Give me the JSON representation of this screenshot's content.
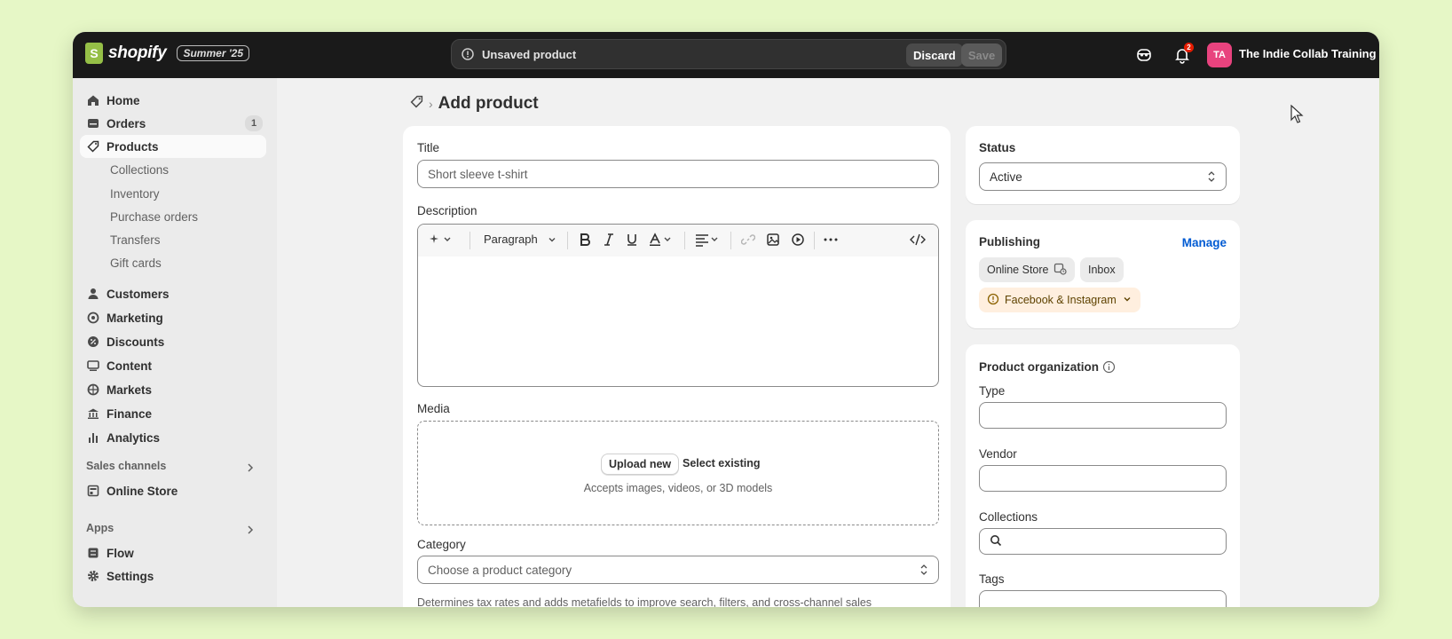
{
  "topbar": {
    "brand": "shopify",
    "logo_mark": "S",
    "edition": "Summer '25",
    "unsaved_label": "Unsaved product",
    "discard_label": "Discard",
    "save_label": "Save",
    "notification_count": "2",
    "avatar_initials": "TA",
    "store_name": "The Indie Collab Training ..."
  },
  "sidebar": {
    "items": [
      {
        "label": "Home",
        "icon": "home-icon"
      },
      {
        "label": "Orders",
        "icon": "orders-icon",
        "count": "1"
      },
      {
        "label": "Products",
        "icon": "tag-icon",
        "active": true
      },
      {
        "label": "Customers",
        "icon": "person-icon"
      },
      {
        "label": "Marketing",
        "icon": "target-icon"
      },
      {
        "label": "Discounts",
        "icon": "discount-icon"
      },
      {
        "label": "Content",
        "icon": "content-icon"
      },
      {
        "label": "Markets",
        "icon": "globe-icon"
      },
      {
        "label": "Finance",
        "icon": "bank-icon"
      },
      {
        "label": "Analytics",
        "icon": "bar-chart-icon"
      }
    ],
    "product_subitems": [
      "Collections",
      "Inventory",
      "Purchase orders",
      "Transfers",
      "Gift cards"
    ],
    "sales_channels_label": "Sales channels",
    "online_store_label": "Online Store",
    "apps_label": "Apps",
    "flow_label": "Flow",
    "settings_label": "Settings"
  },
  "page": {
    "title": "Add product",
    "title_field_label": "Title",
    "title_placeholder": "Short sleeve t-shirt",
    "description_label": "Description",
    "paragraph_format": "Paragraph",
    "media_label": "Media",
    "upload_new_label": "Upload new",
    "select_existing_label": "Select existing",
    "media_hint": "Accepts images, videos, or 3D models",
    "category_label": "Category",
    "category_placeholder": "Choose a product category",
    "category_hint": "Determines tax rates and adds metafields to improve search, filters, and cross-channel sales"
  },
  "status_card": {
    "title": "Status",
    "value": "Active"
  },
  "publishing_card": {
    "title": "Publishing",
    "manage_label": "Manage",
    "channels": [
      "Online Store",
      "Inbox",
      "Facebook & Instagram"
    ]
  },
  "organization_card": {
    "title": "Product organization",
    "type_label": "Type",
    "vendor_label": "Vendor",
    "collections_label": "Collections",
    "tags_label": "Tags"
  },
  "colors": {
    "background": "#e6f7c6",
    "topbar": "#1a1a1a",
    "brand_green": "#95bf47",
    "avatar": "#e8437e",
    "link": "#005bd3",
    "warning_chip": "#ffefdf"
  }
}
